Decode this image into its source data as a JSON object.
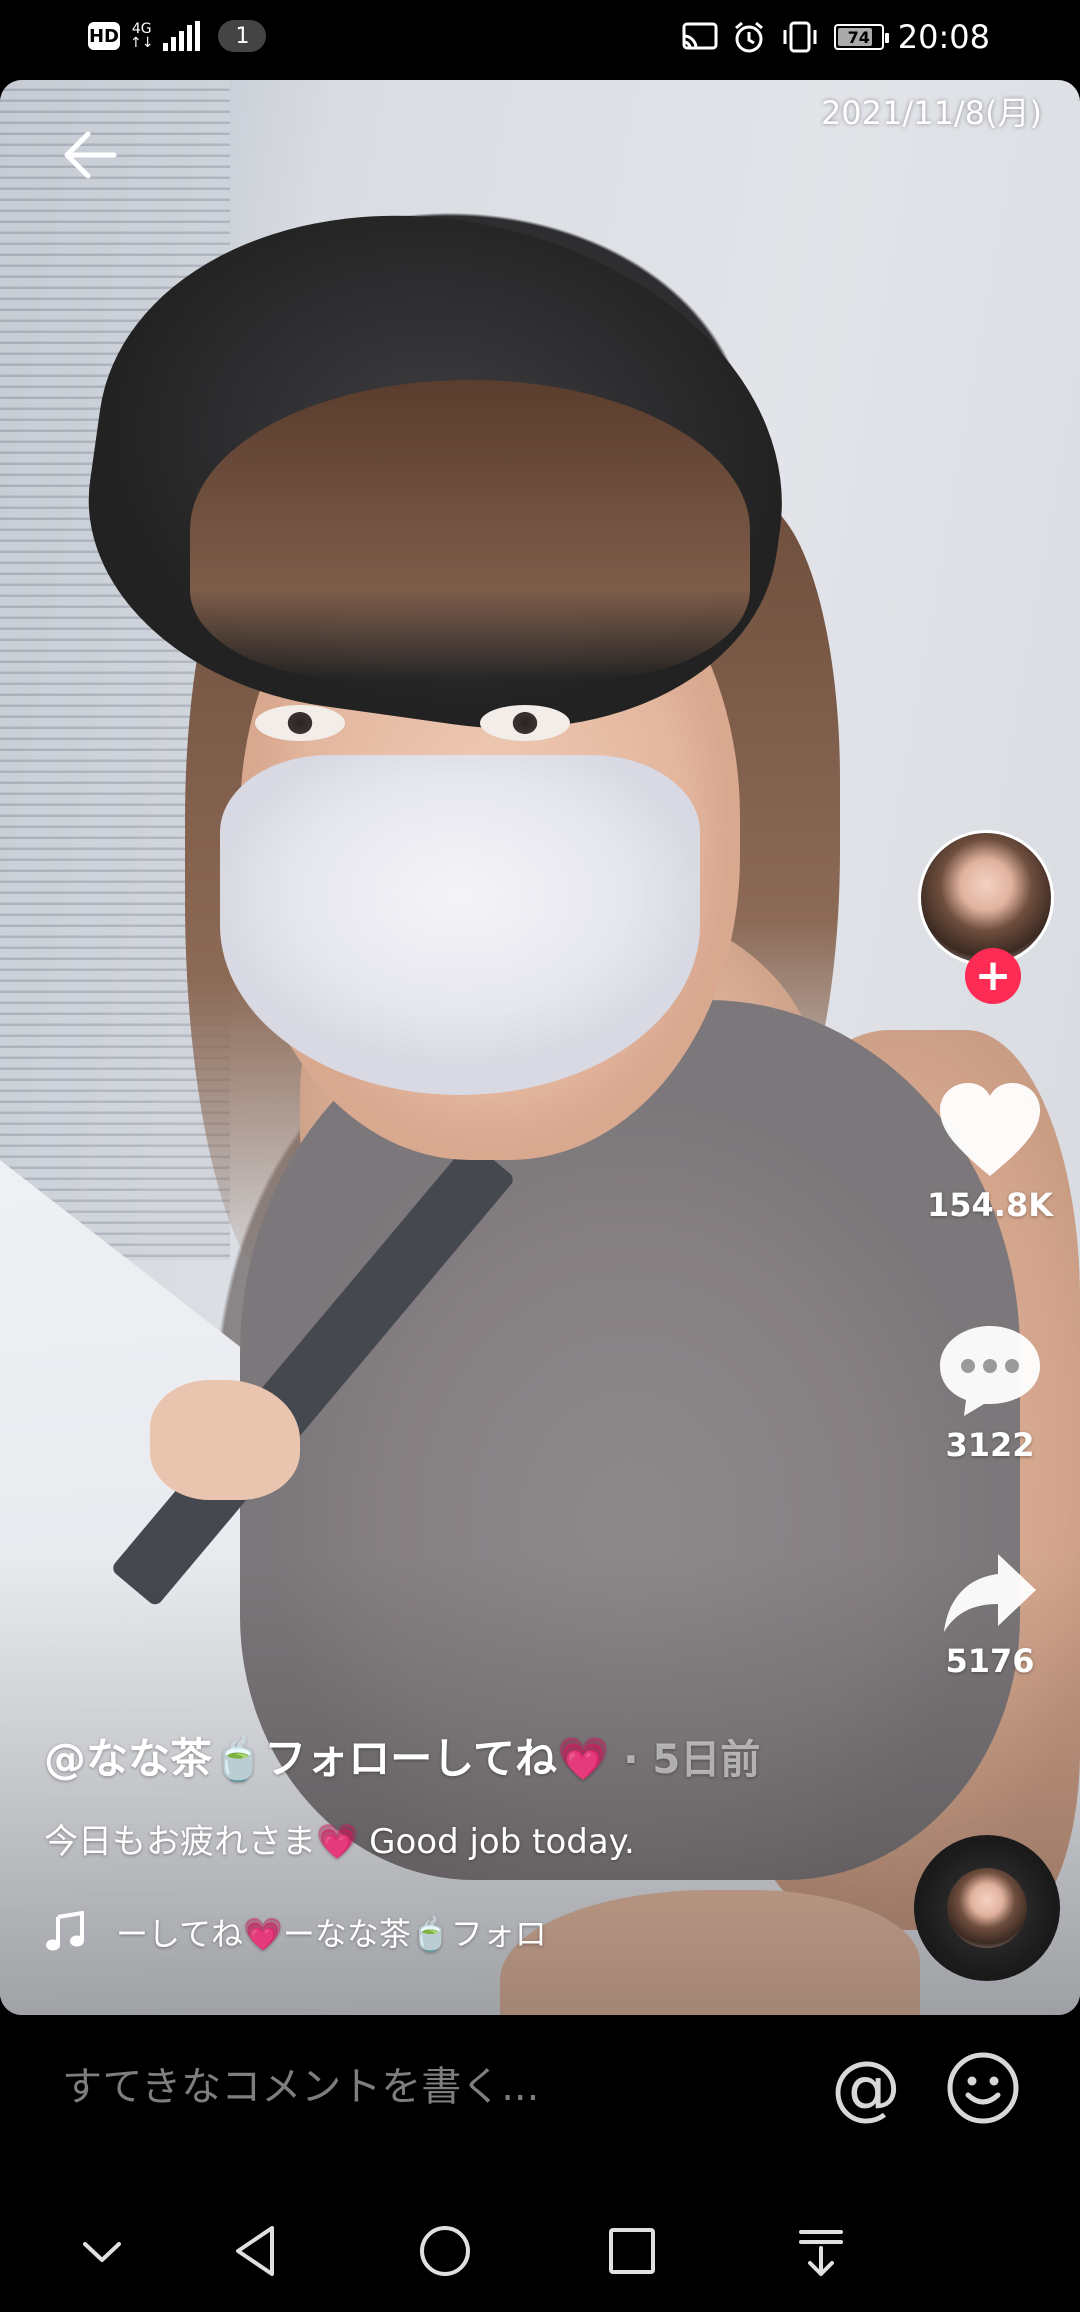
{
  "status_bar": {
    "hd": "HD",
    "network_type_top": "4G",
    "network_type_bottom": "↑↓",
    "notification_count": "1",
    "battery": "74",
    "time": "20:08"
  },
  "video": {
    "date_stamp": "2021/11/8(月)"
  },
  "actions": {
    "likes": "154.8K",
    "comments": "3122",
    "shares": "5176",
    "follow_symbol": "+"
  },
  "caption": {
    "author": "@なな茶🍵フォローしてね💗",
    "separator": " · ",
    "time_ago": "5日前",
    "description": "今日もお疲れさま💗 Good job today.",
    "music": "ーしてね💗ーなな茶🍵フォロ"
  },
  "comment_bar": {
    "placeholder": "すてきなコメントを書く...",
    "at_symbol": "@"
  },
  "colors": {
    "follow_red": "#fe2c55",
    "background": "#000000",
    "placeholder_gray": "#7e7e7e"
  },
  "icons": {
    "back": "arrow-left-icon",
    "like": "heart-icon",
    "comment": "speech-bubble-icon",
    "share": "share-arrow-icon",
    "music": "music-note-icon",
    "emoji": "smiley-icon",
    "nav_collapse": "chevron-down-icon",
    "nav_back": "triangle-back-icon",
    "nav_home": "circle-home-icon",
    "nav_recents": "square-recents-icon",
    "nav_notifications": "pull-down-icon"
  }
}
